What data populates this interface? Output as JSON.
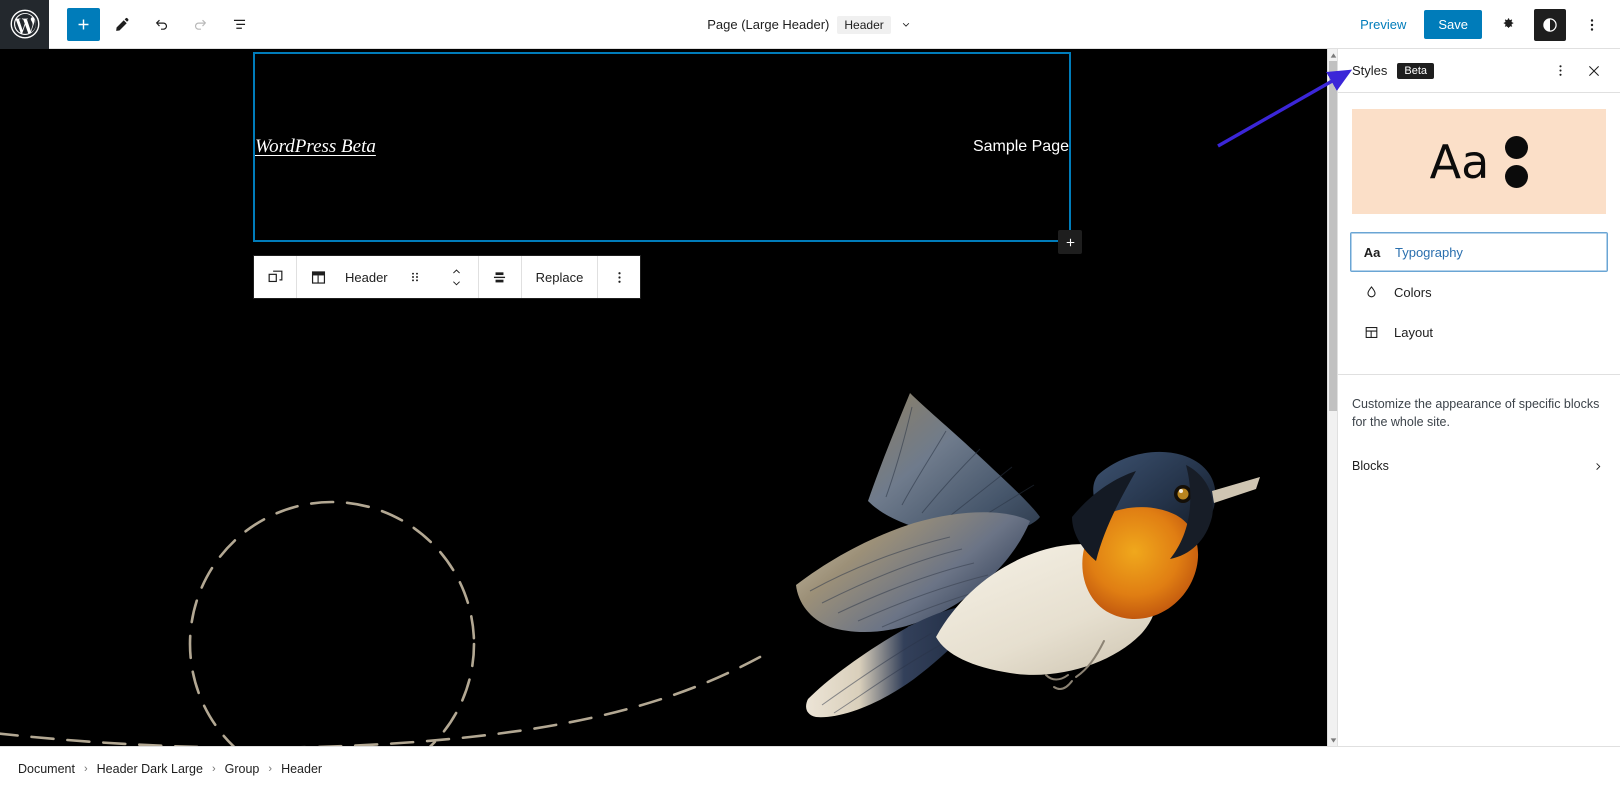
{
  "topbar": {
    "logo": "wordpress-logo",
    "tools": [
      {
        "name": "add-block-button",
        "icon": "plus-icon",
        "label": "Add block"
      },
      {
        "name": "edit-mode-button",
        "icon": "pencil-icon",
        "label": "Edit"
      },
      {
        "name": "undo-button",
        "icon": "undo-icon",
        "label": "Undo"
      },
      {
        "name": "redo-button",
        "icon": "redo-icon",
        "label": "Redo"
      },
      {
        "name": "list-view-button",
        "icon": "list-view-icon",
        "label": "List View"
      }
    ],
    "document_title": "Page (Large Header)",
    "document_badge": "Header",
    "preview_label": "Preview",
    "save_label": "Save",
    "settings_icon": "gear-icon",
    "styles_icon": "contrast-circle-icon",
    "more_icon": "vertical-ellipsis-icon"
  },
  "canvas": {
    "site_title": "WordPress Beta",
    "site_nav_item": "Sample Page",
    "appender_label": "+",
    "block_toolbar": {
      "duplicate_icon": "copy-blocks-icon",
      "block_type_icon": "header-layout-icon",
      "block_type_label": "Header",
      "drag_icon": "drag-handle-dots-icon",
      "move_up_icon": "chevron-up-icon",
      "move_down_icon": "chevron-down-icon",
      "align_icon": "vertical-align-center-icon",
      "replace_label": "Replace",
      "more_icon": "vertical-ellipsis-icon"
    },
    "illustration": "flying-bird-illustration",
    "flight_path": "dashed-loop-path"
  },
  "sidebar": {
    "title": "Styles",
    "badge": "Beta",
    "more_icon": "vertical-ellipsis-icon",
    "close_icon": "close-icon",
    "preview": {
      "sample_text": "Aa",
      "bg_color": "#fbdfc8",
      "dot_color": "#0b0b0b"
    },
    "menu": [
      {
        "label": "Typography",
        "icon": "aa-typography-icon",
        "focused": true
      },
      {
        "label": "Colors",
        "icon": "droplet-icon",
        "focused": false
      },
      {
        "label": "Layout",
        "icon": "layout-grid-icon",
        "focused": false
      }
    ],
    "description": "Customize the appearance of specific blocks for the whole site.",
    "blocks_label": "Blocks",
    "blocks_chevron": "chevron-right-icon"
  },
  "breadcrumb": {
    "separator": "›",
    "items": [
      "Document",
      "Header Dark Large",
      "Group",
      "Header"
    ]
  },
  "colors": {
    "accent": "#007cba",
    "canvas_bg": "#000000",
    "annotation": "#3b26d8",
    "panel_bg": "#ffffff"
  }
}
